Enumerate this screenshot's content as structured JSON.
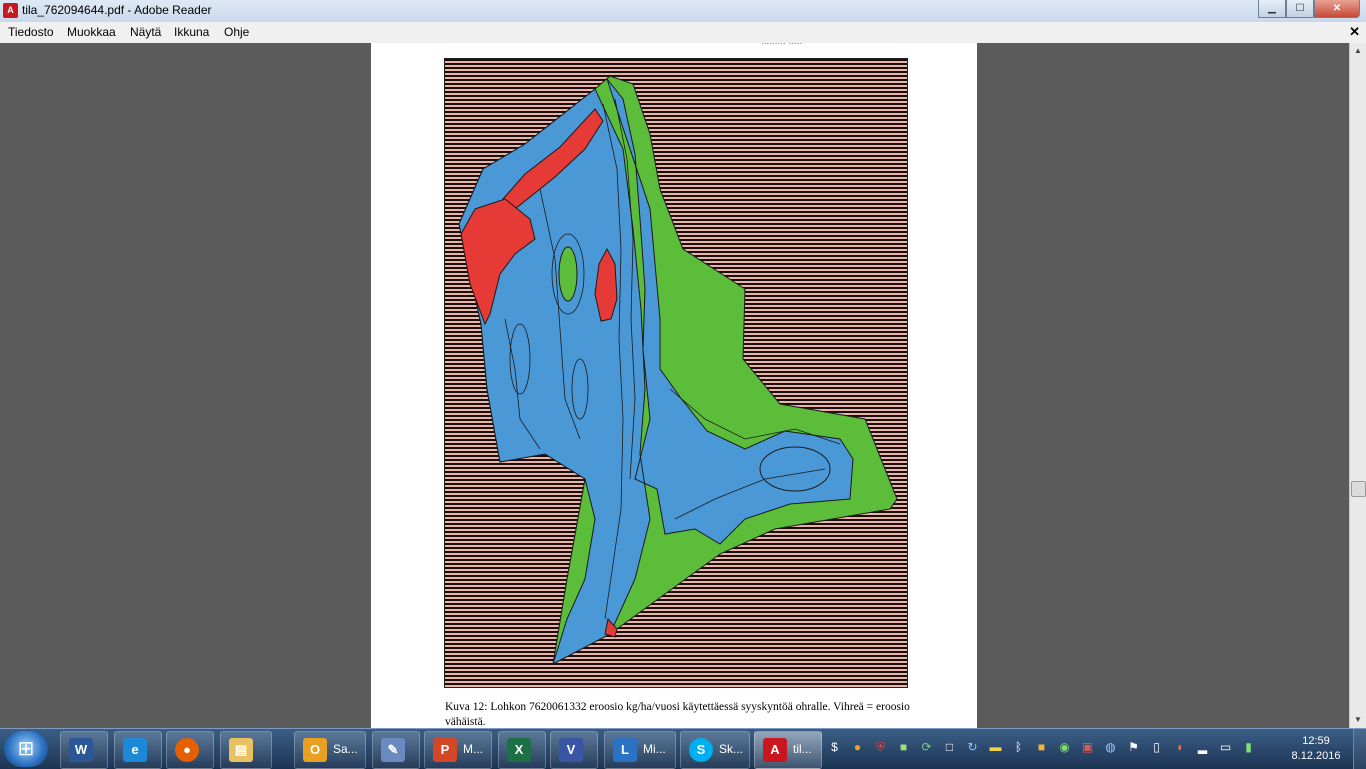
{
  "window": {
    "title": "tila_762094644.pdf - Adobe Reader",
    "app_icon": "pdf-icon"
  },
  "window_controls": {
    "minimize": "▁",
    "maximize": "☐",
    "close": "✕"
  },
  "menu": {
    "items": [
      "Tiedosto",
      "Muokkaa",
      "Näytä",
      "Ikkuna",
      "Ohje"
    ],
    "close_label": "✕"
  },
  "document": {
    "top_fragment": "......... .....",
    "caption": "Kuva 12: Lohkon 7620061332 eroosio kg/ha/vuosi käytettäessä syyskyntöä ohralle. Vihreä = eroosio vähäistä.",
    "map_colors": {
      "low": "#5bbd3a",
      "medium": "#4a99d6",
      "high": "#e53a36",
      "background_stripe": "#1c0f0f"
    }
  },
  "taskbar": {
    "buttons": [
      {
        "icon": "word-icon",
        "label": ""
      },
      {
        "icon": "internet-explorer-icon",
        "label": ""
      },
      {
        "icon": "firefox-icon",
        "label": ""
      },
      {
        "icon": "file-explorer-icon",
        "label": ""
      },
      {
        "icon": "outlook-icon",
        "label": "Sa..."
      },
      {
        "icon": "paint-icon",
        "label": ""
      },
      {
        "icon": "powerpoint-icon",
        "label": "M..."
      },
      {
        "icon": "excel-icon",
        "label": ""
      },
      {
        "icon": "visio-icon",
        "label": ""
      },
      {
        "icon": "lync-icon",
        "label": "Mi..."
      },
      {
        "icon": "skype-icon",
        "label": "Sk..."
      },
      {
        "icon": "adobe-reader-icon",
        "label": "til..."
      }
    ],
    "tray_icons": [
      "dollar-icon",
      "orange-circle-icon",
      "shield-icon",
      "note-icon",
      "sync-icon",
      "square-icon",
      "refresh-icon",
      "folder-icon",
      "bluetooth-icon",
      "app-icon",
      "globe-icon",
      "picture-icon",
      "network-icon",
      "flag-icon",
      "clipboard-icon",
      "volume-icon",
      "signal-icon",
      "monitor-icon",
      "battery-icon"
    ],
    "clock_time": "12:59",
    "clock_date": "8.12.2016"
  }
}
